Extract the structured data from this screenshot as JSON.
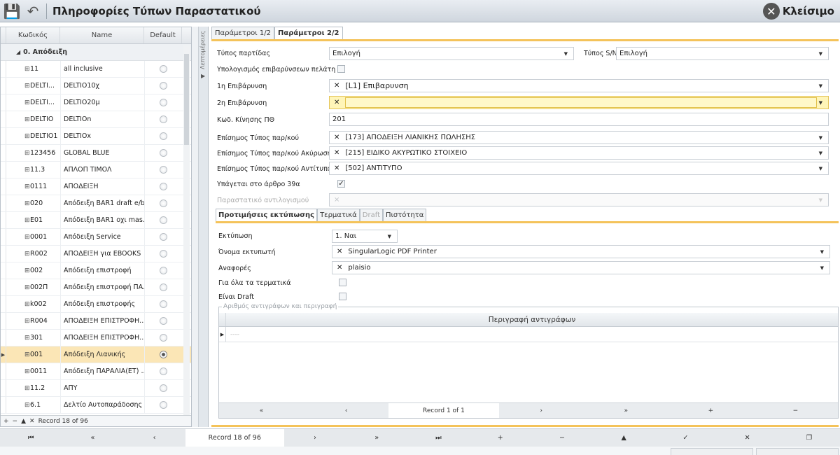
{
  "window": {
    "title": "Πληροφορίες Τύπων Παραστατικού",
    "close_label": "Κλείσιμο"
  },
  "grid": {
    "columns": [
      "Κωδικός",
      "Name",
      "Default"
    ],
    "group_label": "0. Απόδειξη",
    "rows": [
      {
        "code": "11",
        "name": "all inclusive",
        "exp": "⊞",
        "selected": false,
        "default": false
      },
      {
        "code": "DELTI...",
        "name": "DELTIO10χ",
        "exp": "⊞",
        "selected": false,
        "default": false
      },
      {
        "code": "DELTI...",
        "name": "DELTIO20μ",
        "exp": "⊞",
        "selected": false,
        "default": false
      },
      {
        "code": "DELTIO",
        "name": "DELTIOn",
        "exp": "⊞",
        "selected": false,
        "default": false
      },
      {
        "code": "DELTIO1",
        "name": "DELTIOx",
        "exp": "⊞",
        "selected": false,
        "default": false
      },
      {
        "code": "123456",
        "name": "GLOBAL BLUE",
        "exp": "⊞",
        "selected": false,
        "default": false
      },
      {
        "code": "11.3",
        "name": "ΑΠΛΟΠ ΤΙΜΟΛ",
        "exp": "⊞",
        "selected": false,
        "default": false
      },
      {
        "code": "0111",
        "name": "ΑΠΟΔΕΙΞΗ",
        "exp": "⊞",
        "selected": false,
        "default": false
      },
      {
        "code": "020",
        "name": "Απόδειξη BAR1  draft e/b",
        "exp": "⊞",
        "selected": false,
        "default": false
      },
      {
        "code": "E01",
        "name": "Απόδειξη BAR1 οχι mas...",
        "exp": "⊞",
        "selected": false,
        "default": false
      },
      {
        "code": "0001",
        "name": "Απόδειξη Service",
        "exp": "⊞",
        "selected": false,
        "default": false
      },
      {
        "code": "R002",
        "name": "ΑΠΟΔΕΙΞΗ για EBOOKS",
        "exp": "⊞",
        "selected": false,
        "default": false
      },
      {
        "code": "002",
        "name": "Απόδειξη επιστροφή",
        "exp": "⊞",
        "selected": false,
        "default": false
      },
      {
        "code": "002Π",
        "name": "Απόδειξη επιστροφή ΠΑ...",
        "exp": "⊞",
        "selected": false,
        "default": false
      },
      {
        "code": "k002",
        "name": "Απόδειξη επιστροφής",
        "exp": "⊞",
        "selected": false,
        "default": false
      },
      {
        "code": "R004",
        "name": "ΑΠΟΔΕΙΞΗ ΕΠΙΣΤΡΟΦΗ...",
        "exp": "⊞",
        "selected": false,
        "default": false
      },
      {
        "code": "301",
        "name": "ΑΠΟΔΕΙΞΗ ΕΠΙΣΤΡΟΦΗ...",
        "exp": "⊞",
        "selected": false,
        "default": false
      },
      {
        "code": "001",
        "name": "Απόδειξη Λιανικής",
        "exp": "⊞",
        "selected": true,
        "default": true
      },
      {
        "code": "0011",
        "name": "Απόδειξη ΠΑΡΑΛΙΑ(ΕΤ) ...",
        "exp": "⊞",
        "selected": false,
        "default": false
      },
      {
        "code": "11.2",
        "name": "ΑΠΥ",
        "exp": "⊞",
        "selected": false,
        "default": false
      },
      {
        "code": "6.1",
        "name": "Δελτίο Αυτοπαράδοσης",
        "exp": "⊞",
        "selected": false,
        "default": false
      }
    ],
    "nav_record": "Record 18 of 96",
    "nav_controls": [
      "+",
      "−",
      "▲",
      "✕"
    ]
  },
  "side_tab_label": "Λεπτομέρειες",
  "tabs": [
    {
      "label": "Παράμετροι 1/2",
      "active": false
    },
    {
      "label": "Παράμετροι 2/2",
      "active": true
    }
  ],
  "form": {
    "batch_type_label": "Τύπος παρτίδας",
    "batch_type_value": "Επιλογή",
    "sn_type_label": "Τύπος S/N",
    "sn_type_value": "Επιλογή",
    "calc_charges_label": "Υπολογισμός επιβαρύνσεων πελάτη",
    "charge1_label": "1η Επιβάρυνση",
    "charge1_value": "[L1] Επιβαρυνση",
    "charge2_label": "2η Επιβάρυνση",
    "charge2_value": "",
    "pth_label": "Κωδ. Κίνησης ΠΘ",
    "pth_value": "201",
    "official_label": "Επίσημος Τύπος παρ/κού",
    "official_value": "[173] ΑΠΟΔΕΙΞΗ ΛΙΑΝΙΚΗΣ ΠΩΛΗΣΗΣ",
    "official_cancel_label": "Επίσημος Τύπος παρ/κού Ακύρωσης",
    "official_cancel_value": "[215] ΕΙΔΙΚΟ ΑΚΥΡΩΤΙΚΟ ΣΤΟΙΧΕΙΟ",
    "official_copy_label": "Επίσημος Τύπος παρ/κού Αντίτυπου",
    "official_copy_value": "[502] ΑΝΤΙΤΥΠΟ",
    "article39_label": "Υπάγεται στο άρθρο 39α",
    "offset_label": "Παραστατικό αντιλογισμού",
    "offset_value": "×"
  },
  "subtabs": [
    {
      "label": "Προτιμήσεις εκτύπωσης",
      "state": "active"
    },
    {
      "label": "Τερματικά",
      "state": "normal"
    },
    {
      "label": "Draft",
      "state": "disabled"
    },
    {
      "label": "Πιστότητα",
      "state": "normal"
    }
  ],
  "print": {
    "print_label": "Εκτύπωση",
    "print_value": "1. Ναι",
    "printer_label": "Όνομα εκτυπωτή",
    "printer_value": "SingularLogic PDF Printer",
    "reports_label": "Αναφορές",
    "reports_value": "plaisio",
    "all_terminals_label": "Για όλα τα τερματικά",
    "is_draft_label": "Είναι Draft"
  },
  "copies": {
    "group_label": "Αριθμός αντιγράφων και περιγραφή",
    "column_header": "Περιγραφή αντιγράφων",
    "new_row_placeholder": "----",
    "nav": [
      "«",
      "‹",
      "Record 1 of 1",
      "›",
      "»",
      "+",
      "−"
    ]
  },
  "bottom_nav": [
    "⏮",
    "«",
    "‹",
    "Record 18 of 96",
    "›",
    "»",
    "⏭",
    "+",
    "−",
    "▲",
    "✓",
    "✕",
    "❐"
  ]
}
